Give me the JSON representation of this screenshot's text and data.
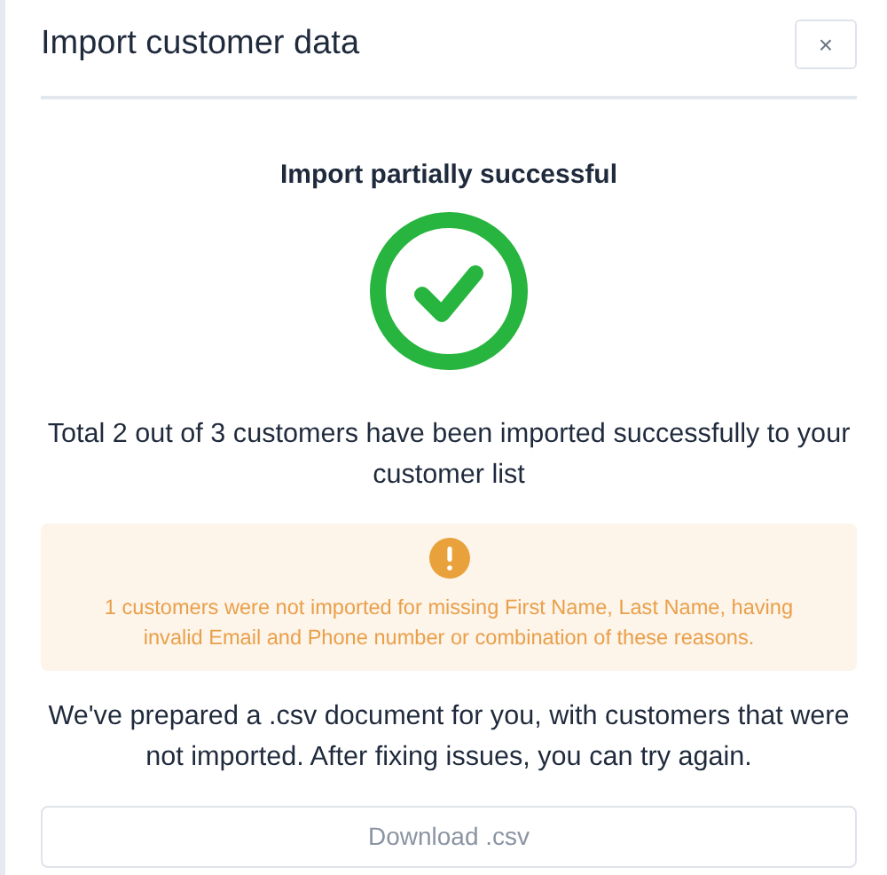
{
  "dialog": {
    "title": "Import customer data",
    "close_label": "×"
  },
  "result": {
    "heading": "Import partially successful",
    "summary": "Total 2 out of 3 customers have been imported successfully to your customer list"
  },
  "warning": {
    "message": "1 customers were not imported for missing First Name, Last Name, having invalid Email and Phone number or combination of these reasons."
  },
  "note": "We've prepared a .csv document for you, with customers that were not imported. After fixing issues, you can try again.",
  "download_button": {
    "label": "Download .csv"
  }
}
